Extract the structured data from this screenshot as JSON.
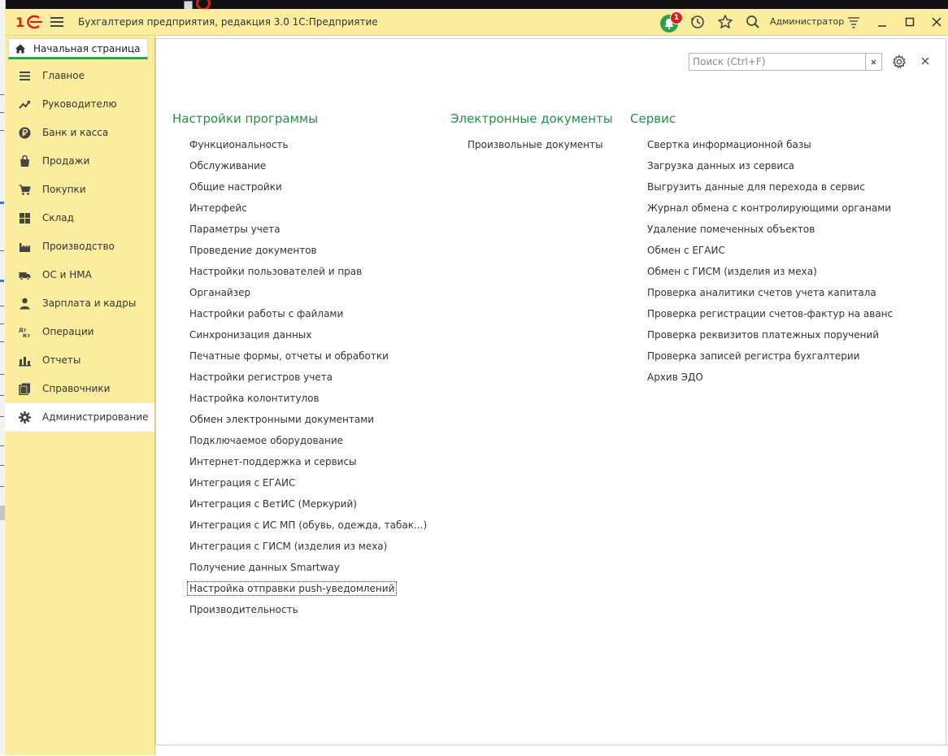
{
  "window": {
    "title": "Бухгалтерия предприятия, редакция 3.0 1С:Предприятие",
    "user": "Администратор",
    "notification_count": "1"
  },
  "colors": {
    "accent_green": "#2a8c4c",
    "panel_yellow": "#fbed9e",
    "logo_red": "#d8201a"
  },
  "sidebar": {
    "home_tab": "Начальная страница",
    "items": [
      {
        "label": "Главное",
        "icon": "list-icon"
      },
      {
        "label": "Руководителю",
        "icon": "trend-icon"
      },
      {
        "label": "Банк и касса",
        "icon": "ruble-icon"
      },
      {
        "label": "Продажи",
        "icon": "sales-icon"
      },
      {
        "label": "Покупки",
        "icon": "cart-icon"
      },
      {
        "label": "Склад",
        "icon": "warehouse-icon"
      },
      {
        "label": "Производство",
        "icon": "factory-icon"
      },
      {
        "label": "ОС и НМА",
        "icon": "truck-icon"
      },
      {
        "label": "Зарплата и кадры",
        "icon": "person-icon"
      },
      {
        "label": "Операции",
        "icon": "dt-kt-icon",
        "icon_text": "Дт Кт"
      },
      {
        "label": "Отчеты",
        "icon": "bar-chart-icon"
      },
      {
        "label": "Справочники",
        "icon": "books-icon"
      },
      {
        "label": "Администрирование",
        "icon": "gear-icon",
        "active": true
      }
    ]
  },
  "search": {
    "placeholder": "Поиск (Ctrl+F)",
    "value": ""
  },
  "sections": [
    {
      "title": "Настройки программы",
      "links": [
        "Функциональность",
        "Обслуживание",
        "Общие настройки",
        "Интерфейс",
        "Параметры учета",
        "Проведение документов",
        "Настройки пользователей и прав",
        "Органайзер",
        "Настройки работы с файлами",
        "Синхронизация данных",
        "Печатные формы, отчеты и обработки",
        "Настройки регистров учета",
        "Настройка колонтитулов",
        "Обмен электронными документами",
        "Подключаемое оборудование",
        "Интернет-поддержка и сервисы",
        "Интеграция с ЕГАИС",
        "Интеграция с ВетИС (Меркурий)",
        "Интеграция с ИС МП (обувь, одежда, табак...)",
        "Интеграция с ГИСМ (изделия из меха)",
        "Получение данных Smartway",
        "Настройка отправки push-уведомлений",
        "Производительность"
      ],
      "focused_index": 21
    },
    {
      "title": "Электронные документы",
      "links": [
        "Произвольные документы"
      ]
    },
    {
      "title": "Сервис",
      "links": [
        "Свертка информационной базы",
        "Загрузка данных из сервиса",
        "Выгрузить данные для перехода в сервис",
        "Журнал обмена с контролирующими органами",
        "Удаление помеченных объектов",
        "Обмен с ЕГАИС",
        "Обмен с ГИСМ (изделия из меха)",
        "Проверка аналитики счетов учета капитала",
        "Проверка регистрации счетов-фактур на аванс",
        "Проверка реквизитов платежных поручений",
        "Проверка записей регистра бухгалтерии",
        "Архив ЭДО"
      ]
    }
  ]
}
